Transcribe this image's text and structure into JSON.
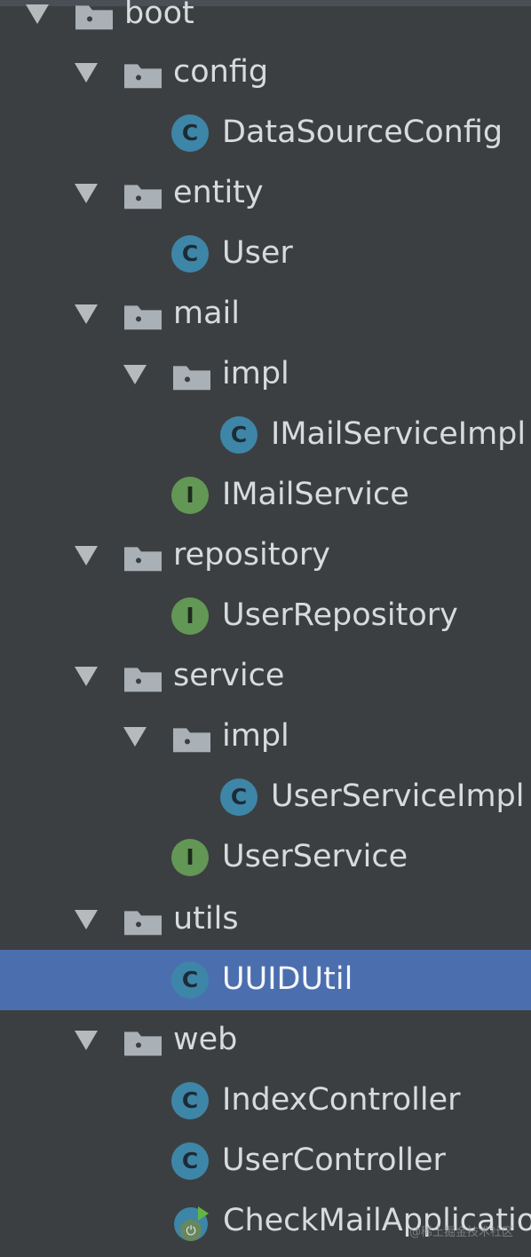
{
  "tree": {
    "items": [
      {
        "label": "boot",
        "type": "package",
        "expanded": true,
        "indent": 0
      },
      {
        "label": "config",
        "type": "package",
        "expanded": true,
        "indent": 1
      },
      {
        "label": "DataSourceConfig",
        "type": "class",
        "indent": 2
      },
      {
        "label": "entity",
        "type": "package",
        "expanded": true,
        "indent": 1
      },
      {
        "label": "User",
        "type": "class",
        "indent": 2
      },
      {
        "label": "mail",
        "type": "package",
        "expanded": true,
        "indent": 1
      },
      {
        "label": "impl",
        "type": "package",
        "expanded": true,
        "indent": 2
      },
      {
        "label": "IMailServiceImpl",
        "type": "class",
        "indent": 3
      },
      {
        "label": "IMailService",
        "type": "interface",
        "indent": 2
      },
      {
        "label": "repository",
        "type": "package",
        "expanded": true,
        "indent": 1
      },
      {
        "label": "UserRepository",
        "type": "interface",
        "indent": 2
      },
      {
        "label": "service",
        "type": "package",
        "expanded": true,
        "indent": 1
      },
      {
        "label": "impl",
        "type": "package",
        "expanded": true,
        "indent": 2
      },
      {
        "label": "UserServiceImpl",
        "type": "class",
        "indent": 3
      },
      {
        "label": "UserService",
        "type": "interface",
        "indent": 2
      },
      {
        "label": "utils",
        "type": "package",
        "expanded": true,
        "indent": 1
      },
      {
        "label": "UUIDUtil",
        "type": "class",
        "indent": 2,
        "selected": true
      },
      {
        "label": "web",
        "type": "package",
        "expanded": true,
        "indent": 1
      },
      {
        "label": "IndexController",
        "type": "class",
        "indent": 2
      },
      {
        "label": "UserController",
        "type": "class",
        "indent": 2
      },
      {
        "label": "CheckMailApplication",
        "type": "spring-boot-class",
        "indent": 1
      }
    ]
  },
  "icons": {
    "package": "folder-icon",
    "class": "class-icon",
    "interface": "interface-icon",
    "spring-boot-class": "spring-boot-icon",
    "expanded": "expand-arrow-icon"
  },
  "colors": {
    "background": "#3c3f41",
    "selection": "#4b6eaf",
    "class_icon": "#3e86a8",
    "interface_icon": "#629755",
    "text": "#d8dbdd"
  },
  "icon_letters": {
    "class": "C",
    "interface": "I"
  },
  "watermark": "@稀土掘金技术社区"
}
